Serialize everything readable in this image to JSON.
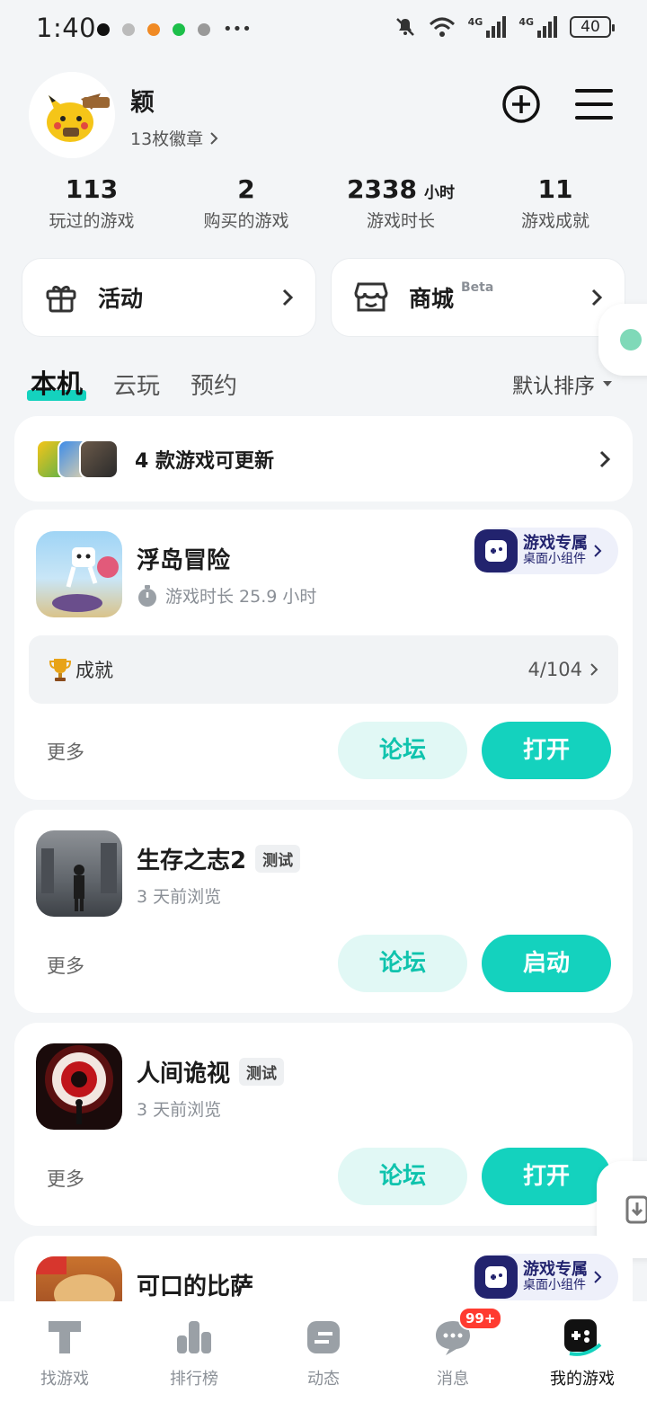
{
  "status_bar": {
    "time": "1:40",
    "battery": "40",
    "network1": "4G",
    "network2": "4G"
  },
  "profile": {
    "name": "颖",
    "badges": "13枚徽章"
  },
  "stats": [
    {
      "value": "113",
      "unit": "",
      "label": "玩过的游戏"
    },
    {
      "value": "2",
      "unit": "",
      "label": "购买的游戏"
    },
    {
      "value": "2338",
      "unit": "小时",
      "label": "游戏时长"
    },
    {
      "value": "11",
      "unit": "",
      "label": "游戏成就"
    }
  ],
  "quick": {
    "activity": "活动",
    "mall": "商城",
    "mall_tag": "Beta"
  },
  "tabs": {
    "local": "本机",
    "cloud": "云玩",
    "reserve": "预约",
    "sort": "默认排序"
  },
  "update": {
    "text": "4 款游戏可更新"
  },
  "games": [
    {
      "title": "浮岛冒险",
      "sub": "游戏时长 25.9 小时",
      "widget_l1": "游戏专属",
      "widget_l2": "桌面小组件",
      "ach_label": "成就",
      "ach_value": "4/104",
      "more": "更多",
      "forum": "论坛",
      "action": "打开"
    },
    {
      "title": "生存之志2",
      "tag": "测试",
      "sub": "3 天前浏览",
      "more": "更多",
      "forum": "论坛",
      "action": "启动"
    },
    {
      "title": "人间诡视",
      "tag": "测试",
      "sub": "3 天前浏览",
      "more": "更多",
      "forum": "论坛",
      "action": "打开"
    },
    {
      "title": "可口的比萨",
      "widget_l1": "游戏专属",
      "widget_l2": "桌面小组件"
    }
  ],
  "nav": [
    {
      "label": "找游戏",
      "icon": "find-game-icon"
    },
    {
      "label": "排行榜",
      "icon": "ranking-icon"
    },
    {
      "label": "动态",
      "icon": "feed-icon"
    },
    {
      "label": "消息",
      "icon": "message-icon",
      "badge": "99+"
    },
    {
      "label": "我的游戏",
      "icon": "my-games-icon"
    }
  ],
  "colors": {
    "accent": "#14d2be",
    "widget": "#22236e",
    "badge": "#ff3b30"
  }
}
